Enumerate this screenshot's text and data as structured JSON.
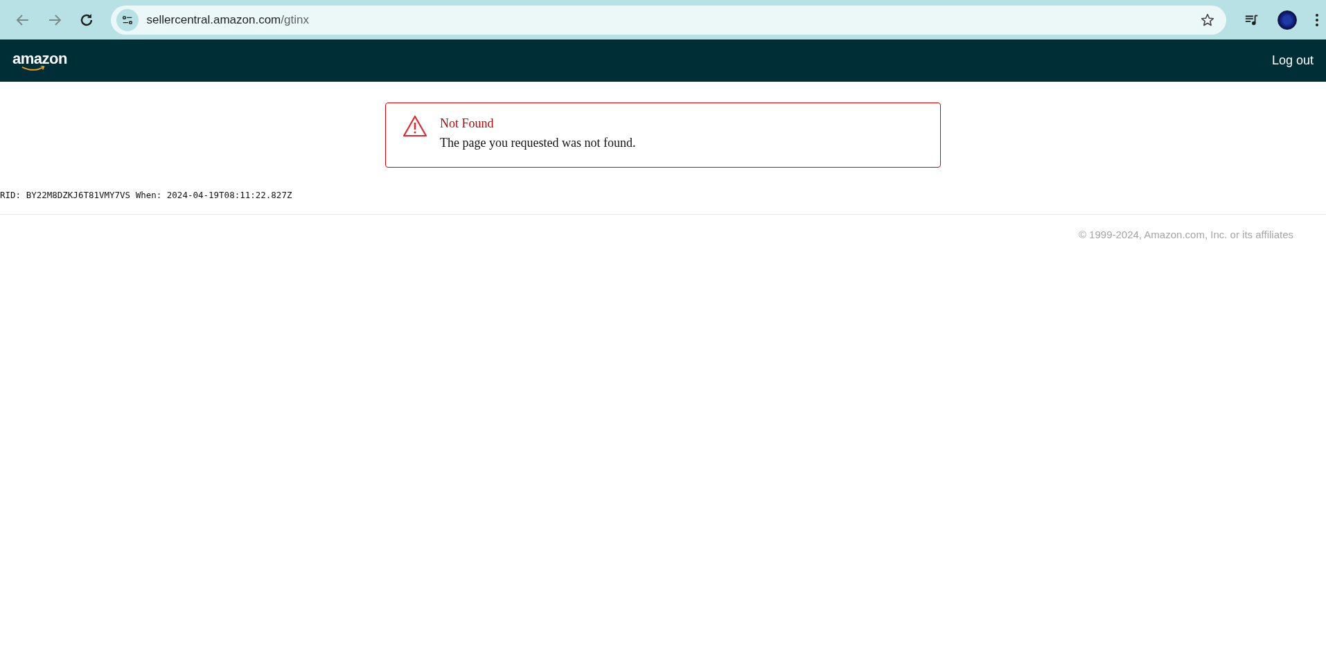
{
  "browser": {
    "url_host": "sellercentral.amazon.com",
    "url_path": "/gtinx"
  },
  "header": {
    "logo": "amazon",
    "logout": "Log out"
  },
  "alert": {
    "title": "Not Found",
    "message": "The page you requested was not found."
  },
  "request_info": "RID: BY22M8DZKJ6T81VMY7VS When: 2024-04-19T08:11:22.827Z",
  "footer": {
    "copyright": "© 1999-2024, Amazon.com, Inc. or its affiliates"
  }
}
